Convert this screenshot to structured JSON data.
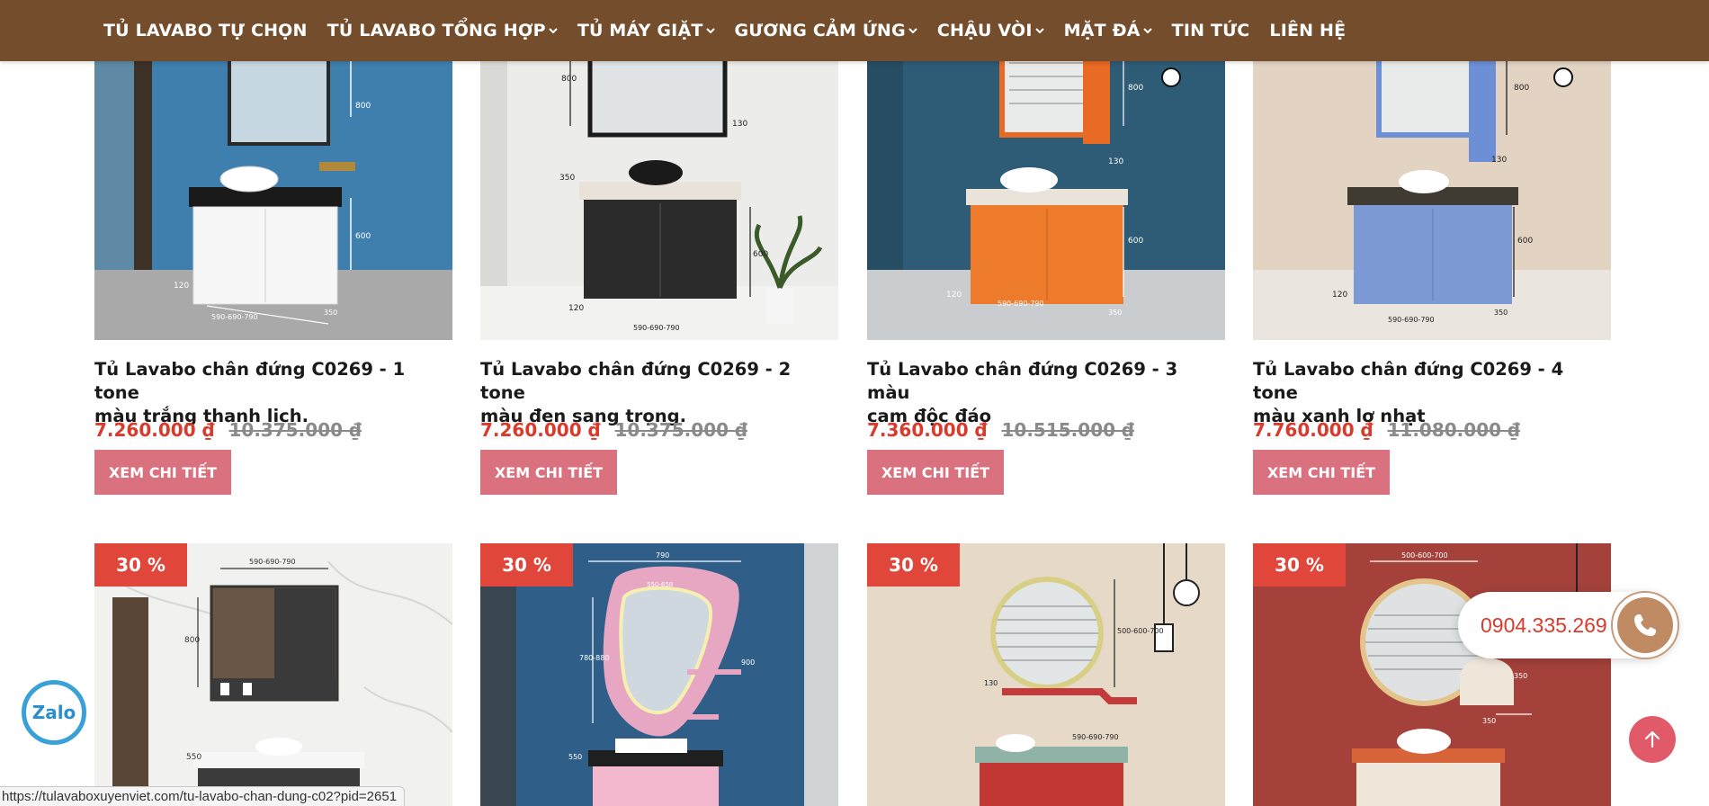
{
  "nav": {
    "items": [
      {
        "label": "TỦ LAVABO TỰ CHỌN",
        "has_dropdown": false
      },
      {
        "label": "TỦ LAVABO TỔNG HỢP",
        "has_dropdown": true
      },
      {
        "label": "TỦ MÁY GIẶT",
        "has_dropdown": true
      },
      {
        "label": "GƯƠNG CẢM ỨNG",
        "has_dropdown": true
      },
      {
        "label": "CHẬU VÒI",
        "has_dropdown": true
      },
      {
        "label": "MẶT ĐÁ",
        "has_dropdown": true
      },
      {
        "label": "TIN TỨC",
        "has_dropdown": false
      },
      {
        "label": "LIÊN HỆ",
        "has_dropdown": false
      }
    ]
  },
  "products": [
    {
      "title_line1": "Tủ Lavabo chân đứng C0269 - 1 tone",
      "title_line2": "màu trắng thanh lịch.",
      "price": "7.260.000 ₫",
      "old_price": "10.375.000 ₫",
      "button": "XEM CHI TIẾT"
    },
    {
      "title_line1": "Tủ Lavabo chân đứng C0269 - 2 tone",
      "title_line2": "màu đen sang trọng.",
      "price": "7.260.000 ₫",
      "old_price": "10.375.000 ₫",
      "button": "XEM CHI TIẾT"
    },
    {
      "title_line1": "Tủ Lavabo chân đứng C0269 - 3 màu",
      "title_line2": "cam độc đáo",
      "price": "7.360.000 ₫",
      "old_price": "10.515.000 ₫",
      "button": "XEM CHI TIẾT"
    },
    {
      "title_line1": "Tủ Lavabo chân đứng C0269 - 4 tone",
      "title_line2": "màu xanh lơ nhạt",
      "price": "7.760.000 ₫",
      "old_price": "11.080.000 ₫",
      "button": "XEM CHI TIẾT"
    }
  ],
  "products_row2": [
    {
      "badge": "30 %"
    },
    {
      "badge": "30 %"
    },
    {
      "badge": "30 %"
    },
    {
      "badge": "30 %"
    }
  ],
  "image_dimension_labels": {
    "p1": [
      "800",
      "600",
      "120",
      "590-690-790",
      "350"
    ],
    "p2": [
      "800",
      "130",
      "350",
      "600",
      "120",
      "590-690-790"
    ],
    "p3": [
      "800",
      "130",
      "600",
      "120",
      "590-690-790",
      "350"
    ],
    "p4": [
      "800",
      "130",
      "600",
      "120",
      "590-690-790",
      "350"
    ],
    "p5": [
      "590-690-790",
      "800",
      "550"
    ],
    "p6": [
      "790",
      "550-658",
      "780-880",
      "900",
      "550"
    ],
    "p7": [
      "500-600-700",
      "130",
      "590-690-790"
    ],
    "p8": [
      "500-600-700",
      "350",
      "350"
    ]
  },
  "contact": {
    "phone": "0904.335.269",
    "zalo_label": "Zalo"
  },
  "status_bar": {
    "url": "https://tulavaboxuyenviet.com/tu-lavabo-chan-dung-c02?pid=2651"
  },
  "colors": {
    "nav_bg": "#744d2c",
    "price_red": "#d93a2b",
    "button_pink": "#d9717e",
    "badge_red": "#e0473a",
    "scroll_top": "#e15a6a",
    "zalo_blue": "#3aa0d8"
  },
  "icons": {
    "nav_dropdown": "chevron-down-icon",
    "phone": "phone-icon",
    "scroll_top": "arrow-up-icon"
  }
}
